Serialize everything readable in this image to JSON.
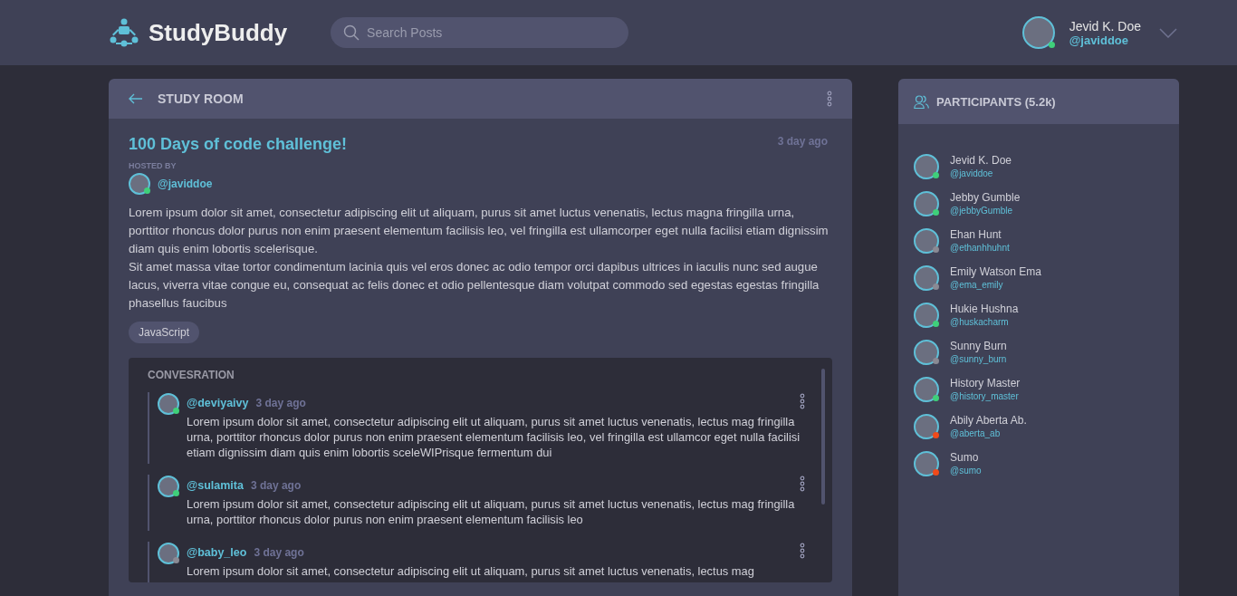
{
  "header": {
    "logo": "StudyBuddy",
    "search": {
      "placeholder": "Search Posts"
    },
    "user": {
      "name": "Jevid K. Doe",
      "handle": "@javiddoe",
      "color": "#3fd07a"
    }
  },
  "room": {
    "title": "STUDY ROOM",
    "post": {
      "title": "100 Days of code challenge!",
      "time": "3 day ago",
      "hosted_label": "HOSTED BY",
      "host": {
        "handle": "@javiddoe",
        "color": "#3fd07a"
      },
      "paragraphs": [
        "Lorem ipsum dolor sit amet, consectetur adipiscing elit ut aliquam, purus sit amet luctus venenatis, lectus magna fringilla urna, porttitor rhoncus dolor purus non enim praesent elementum facilisis leo, vel fringilla est ullamcorper eget nulla facilisi etiam dignissim diam quis enim lobortis scelerisque.",
        "Sit amet massa vitae tortor condimentum lacinia quis vel eros donec ac odio tempor orci dapibus ultrices in iaculis nunc sed augue lacus, viverra vitae congue eu, consequat ac felis donec et odio pellentesque diam volutpat commodo sed egestas egestas fringilla phasellus faucibus"
      ],
      "tags": [
        "JavaScript"
      ]
    },
    "conversation": {
      "title": "CONVESRATION",
      "comments": [
        {
          "handle": "@deviyaivy",
          "time": "3 day ago",
          "color": "#3fd07a",
          "text": "Lorem ipsum dolor sit amet, consectetur adipiscing elit ut aliquam, purus sit amet luctus venenatis, lectus mag fringilla urna, porttitor rhoncus dolor purus non enim praesent elementum facilisis leo, vel fringilla est ullamcor eget nulla facilisi etiam dignissim diam quis enim lobortis sceleWIPrisque fermentum dui"
        },
        {
          "handle": "@sulamita",
          "time": "3 day ago",
          "color": "#3fd07a",
          "text": "Lorem ipsum dolor sit amet, consectetur adipiscing elit ut aliquam, purus sit amet luctus venenatis, lectus mag fringilla urna, porttitor rhoncus dolor purus non enim praesent elementum facilisis leo"
        },
        {
          "handle": "@baby_leo",
          "time": "3 day ago",
          "color": "#8a8a94",
          "text": "Lorem ipsum dolor sit amet, consectetur adipiscing elit ut aliquam, purus sit amet luctus venenatis, lectus mag"
        }
      ]
    }
  },
  "participants": {
    "title": "PARTICIPANTS (5.2k)",
    "items": [
      {
        "name": "Jevid K. Doe",
        "handle": "@javiddoe",
        "color": "#3fd07a"
      },
      {
        "name": "Jebby Gumble",
        "handle": "@jebbyGumble",
        "color": "#3fd07a"
      },
      {
        "name": "Ehan Hunt",
        "handle": "@ethanhhuhnt",
        "color": "#8a8a94"
      },
      {
        "name": "Emily Watson Ema",
        "handle": "@ema_emily",
        "color": "#8a8a94"
      },
      {
        "name": "Hukie Hushna",
        "handle": "@huskacharm",
        "color": "#3fd07a"
      },
      {
        "name": "Sunny Burn",
        "handle": "@sunny_burn",
        "color": "#8a8a94"
      },
      {
        "name": "History Master",
        "handle": "@history_master",
        "color": "#3fd07a"
      },
      {
        "name": "Abily Aberta Ab.",
        "handle": "@aberta_ab",
        "color": "#f04a1a"
      },
      {
        "name": "Sumo",
        "handle": "@sumo",
        "color": "#f04a1a"
      }
    ]
  }
}
